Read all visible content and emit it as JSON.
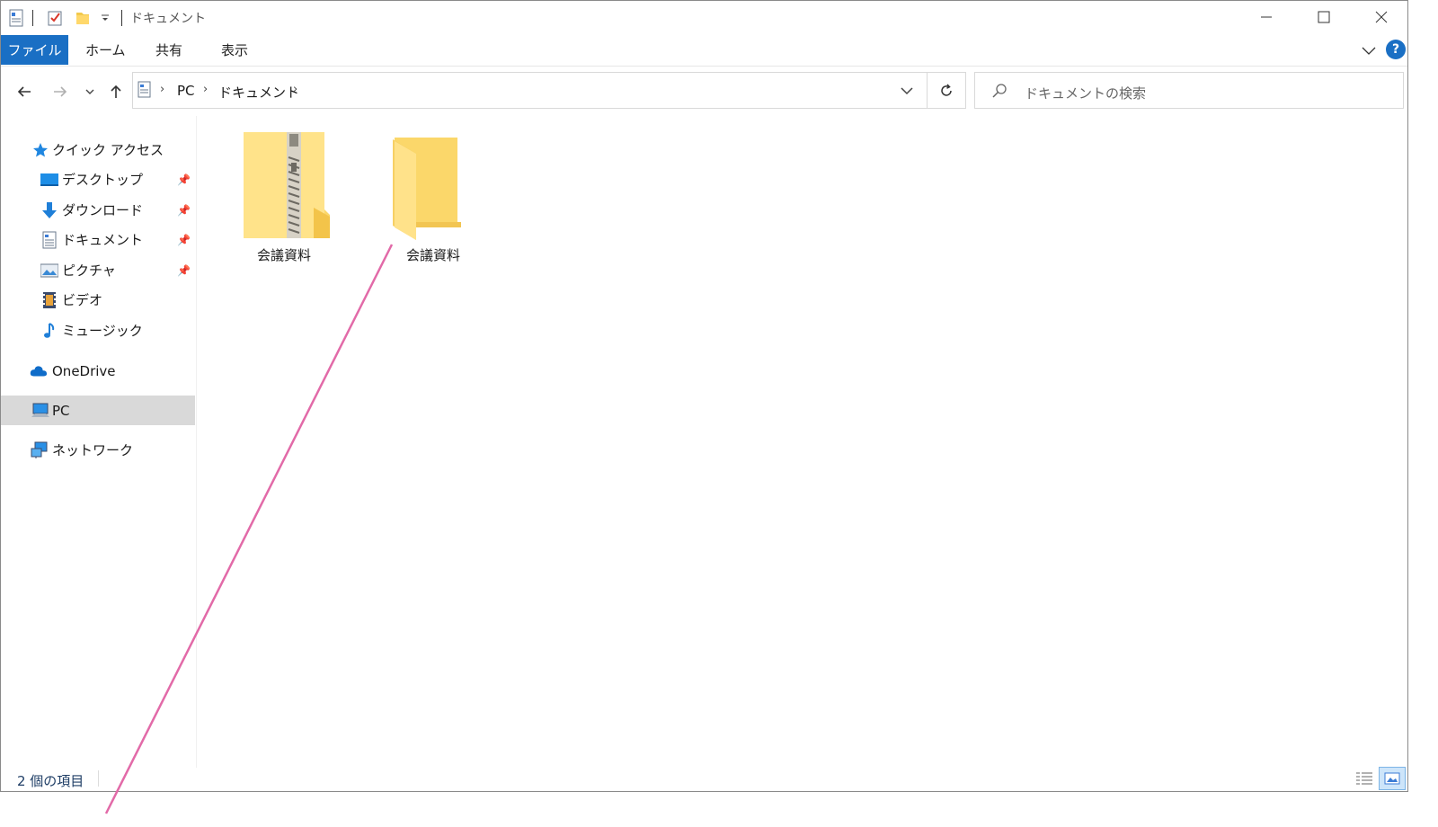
{
  "window": {
    "title": "ドキュメント",
    "controls": {
      "minimize": "minimize-icon",
      "maximize": "maximize-icon",
      "close": "close-icon"
    }
  },
  "ribbon": {
    "tabs": [
      "ファイル",
      "ホーム",
      "共有",
      "表示"
    ],
    "active_tab": "ファイル",
    "accent_color": "#1a6fc4"
  },
  "address_bar": {
    "breadcrumbs": [
      "PC",
      "ドキュメント"
    ]
  },
  "search": {
    "placeholder": "ドキュメントの検索"
  },
  "sidebar": {
    "quick_access": {
      "label": "クイック アクセス",
      "items": [
        {
          "label": "デスクトップ",
          "icon": "desktop-icon",
          "pinned": true
        },
        {
          "label": "ダウンロード",
          "icon": "download-icon",
          "pinned": true
        },
        {
          "label": "ドキュメント",
          "icon": "document-icon",
          "pinned": true
        },
        {
          "label": "ピクチャ",
          "icon": "picture-icon",
          "pinned": true
        },
        {
          "label": "ビデオ",
          "icon": "video-icon",
          "pinned": false
        },
        {
          "label": "ミュージック",
          "icon": "music-icon",
          "pinned": false
        }
      ]
    },
    "onedrive": {
      "label": "OneDrive"
    },
    "pc": {
      "label": "PC",
      "selected": true
    },
    "network": {
      "label": "ネットワーク"
    }
  },
  "files": [
    {
      "name": "会議資料",
      "type": "zip-folder",
      "icon": "zip-folder-icon"
    },
    {
      "name": "会議資料",
      "type": "folder",
      "icon": "folder-icon"
    }
  ],
  "status_bar": {
    "item_count": "2 個の項目"
  },
  "annotation_color": "#e26aa8"
}
